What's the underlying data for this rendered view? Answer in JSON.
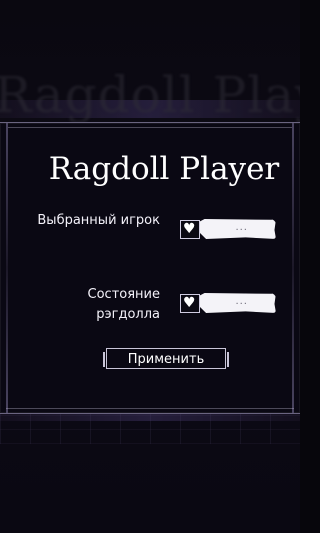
{
  "background": {
    "ghost_title": "Ragdoll Player"
  },
  "dialog": {
    "title": "Ragdoll Player",
    "rows": [
      {
        "label": "Выбранный игрок",
        "icon": "heart-icon",
        "value": "..."
      },
      {
        "label": "Состояние рэгдолла",
        "icon": "heart-icon",
        "value": "..."
      }
    ],
    "apply_label": "Применить"
  },
  "colors": {
    "dialog_bg": "#0a0813",
    "text": "#ffffff",
    "accent_band": "#3a2f5c"
  }
}
